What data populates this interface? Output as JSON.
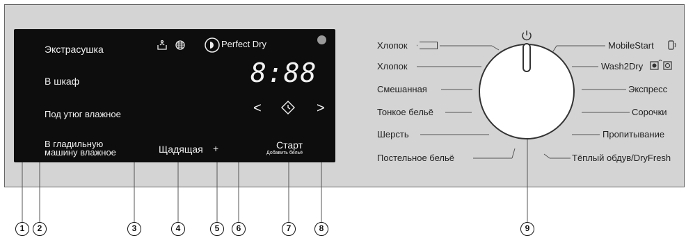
{
  "display": {
    "dry_levels": [
      "Экстрасушка",
      "В шкаф",
      "Под утюг влажное",
      "В гладильную машину влажное"
    ],
    "perfect_dry": "Perfect Dry",
    "time": "8:88",
    "gentle": "Щадящая",
    "start": "Старт",
    "add_laundry": "Добавить бельё"
  },
  "programs_left": [
    "Хлопок",
    "Хлопок",
    "Смешанная",
    "Тонкое бельё",
    "Шерсть",
    "Постельное бельё"
  ],
  "programs_right": [
    "MobileStart",
    "Wash2Dry",
    "Экспресс",
    "Сорочки",
    "Пропитывание",
    "Тёплый обдув/DryFresh"
  ],
  "callouts": [
    "1",
    "2",
    "3",
    "4",
    "5",
    "6",
    "7",
    "8",
    "9"
  ],
  "colors": {
    "panel": "#d4d4d4",
    "display": "#0d0d0d",
    "display_text": "#f2f2f2"
  }
}
